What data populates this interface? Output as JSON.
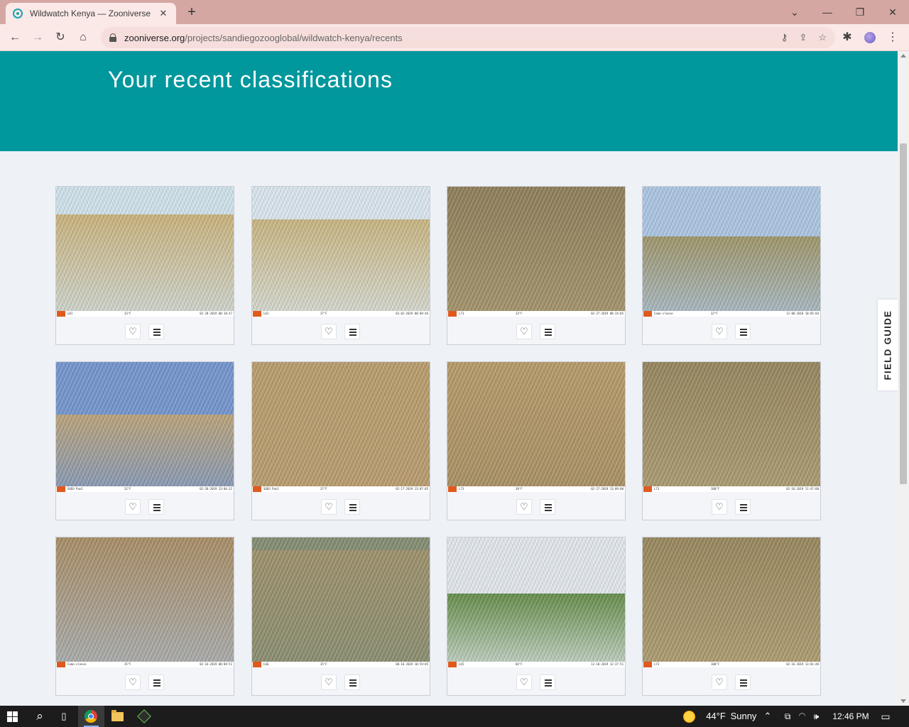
{
  "browser": {
    "tab_title": "Wildwatch Kenya — Zooniverse",
    "tab_close": "✕",
    "new_tab": "+",
    "url_host": "zooniverse.org",
    "url_path": "/projects/sandiegozooglobal/wildwatch-kenya/recents",
    "window_controls": {
      "dropdown": "⌄",
      "minimize": "—",
      "restore": "❐",
      "close": "✕"
    },
    "nav": {
      "back": "←",
      "forward": "→",
      "reload": "↻",
      "home": "⌂"
    },
    "omni_icons": {
      "key": "⚷",
      "share": "⇪",
      "bookmark": "☆"
    },
    "toolbar_icons": {
      "extensions": "✱",
      "menu": "⋮"
    }
  },
  "page": {
    "heading": "Your recent classifications",
    "field_guide": "FIELD GUIDE",
    "fav_glyph": "♡"
  },
  "classifications": [
    {
      "site": "L01",
      "temp": "33°F",
      "date": "02-28-2019 08:18:47",
      "sky": "#cfe3ef",
      "ground": "#c9b27a",
      "horizon": 22
    },
    {
      "site": "L01",
      "temp": "37°F",
      "date": "03-02-2019 08:09:46",
      "sky": "#dbe8f2",
      "ground": "#c7b47e",
      "horizon": 26
    },
    {
      "site": "L73",
      "temp": "33°F",
      "date": "02-27-2019 08:24:05",
      "sky": "#a99a6f",
      "ground": "#8b7a55",
      "horizon": 0
    },
    {
      "site": "Camo-sleeve",
      "temp": "32°F",
      "date": "12-08-2018 10:05:04",
      "sky": "#a9c6e6",
      "ground": "#9c9366",
      "horizon": 40
    },
    {
      "site": "SOEO Pan1",
      "temp": "32°F",
      "date": "02-28-2019 13:04:32",
      "sky": "#6f93cf",
      "ground": "#b9a177",
      "horizon": 42
    },
    {
      "site": "SOEO Pan1",
      "temp": "37°F",
      "date": "02-17-2019 13:07:05",
      "sky": "#b89a6c",
      "ground": "#b79a6a",
      "horizon": 0
    },
    {
      "site": "L73",
      "temp": "38°F",
      "date": "02-27-2019 13:09:00",
      "sky": "#a08a5f",
      "ground": "#b59866",
      "horizon": 0
    },
    {
      "site": "L73",
      "temp": "100°F",
      "date": "02-16-2019 11:47:08",
      "sky": "#b1a275",
      "ground": "#93825a",
      "horizon": 0
    },
    {
      "site": "Camo-sleeve",
      "temp": "35°F",
      "date": "02-16-2019 08:09:51",
      "sky": "#a8b7c8",
      "ground": "#a68a62",
      "horizon": 0
    },
    {
      "site": "L66",
      "temp": "35°F",
      "date": "08-16-2019 10:59:05",
      "sky": "#7f8a70",
      "ground": "#9a8e68",
      "horizon": 10
    },
    {
      "site": "L65",
      "temp": "84°F",
      "date": "12-10-2019 12:37:51",
      "sky": "#e2e9f1",
      "ground": "#5e8a44",
      "horizon": 45
    },
    {
      "site": "L73",
      "temp": "100°F",
      "date": "02-16-2019 13:01:48",
      "sky": "#b3a276",
      "ground": "#958459",
      "horizon": 0
    }
  ],
  "taskbar": {
    "search": "⌕",
    "task_view": "▯",
    "weather_temp": "44°F",
    "weather_text": "Sunny",
    "tray_chevron": "⌃",
    "tray_icons": "⧉ ◠ 🕪",
    "time": "12:46 PM",
    "notifications": "▭"
  }
}
